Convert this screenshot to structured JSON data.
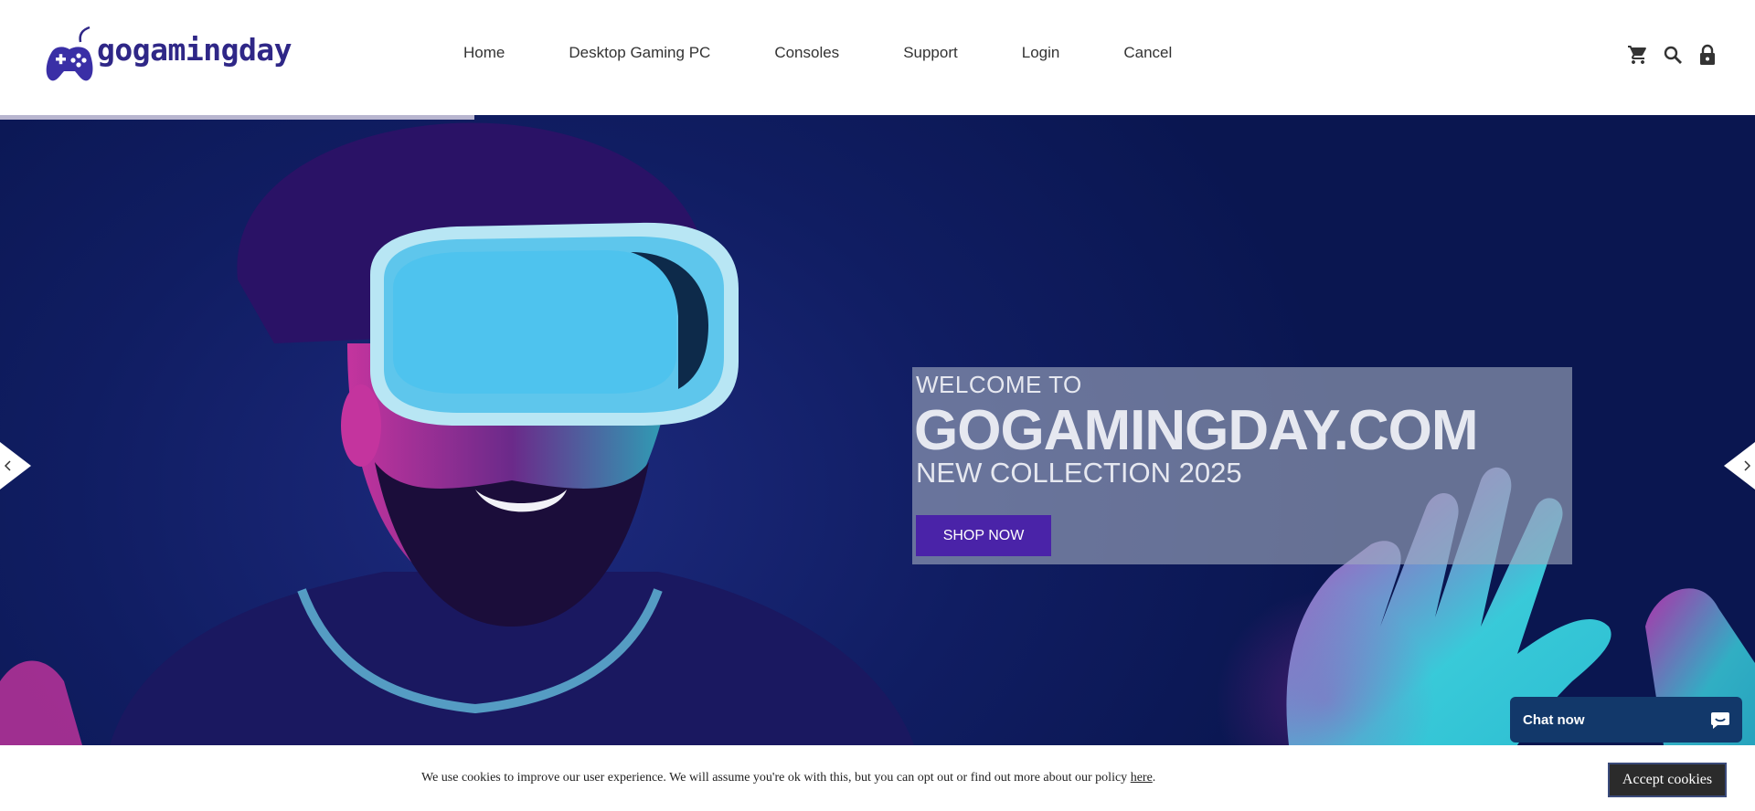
{
  "brand": {
    "name": "gogamingday"
  },
  "nav": {
    "items": [
      {
        "label": "Home"
      },
      {
        "label": "Desktop Gaming PC"
      },
      {
        "label": "Consoles"
      },
      {
        "label": "Support"
      },
      {
        "label": "Login"
      },
      {
        "label": "Cancel"
      }
    ]
  },
  "header_icons": [
    "cart-icon",
    "search-icon",
    "lock-icon"
  ],
  "hero": {
    "welcome": "WELCOME TO",
    "site": "GOGAMINGDAY.COM",
    "collection": "NEW COLLECTION 2025",
    "button": "SHOP NOW",
    "prev_icon": "chevron-left-icon",
    "next_icon": "chevron-right-icon"
  },
  "chat": {
    "label": "Chat now",
    "icon": "chat-bubble-icon"
  },
  "cookie": {
    "text": "We use cookies to improve our user experience. We will assume you're ok with this, but you can opt out or find out more about our policy ",
    "link": "here",
    "end": ".",
    "accept": "Accept cookies"
  },
  "colors": {
    "brand": "#2f2787",
    "button": "#4a23a8",
    "hero_bg": "#101d62",
    "chat_bg": "#12386a",
    "cookie_btn": "#2b2b2b"
  }
}
